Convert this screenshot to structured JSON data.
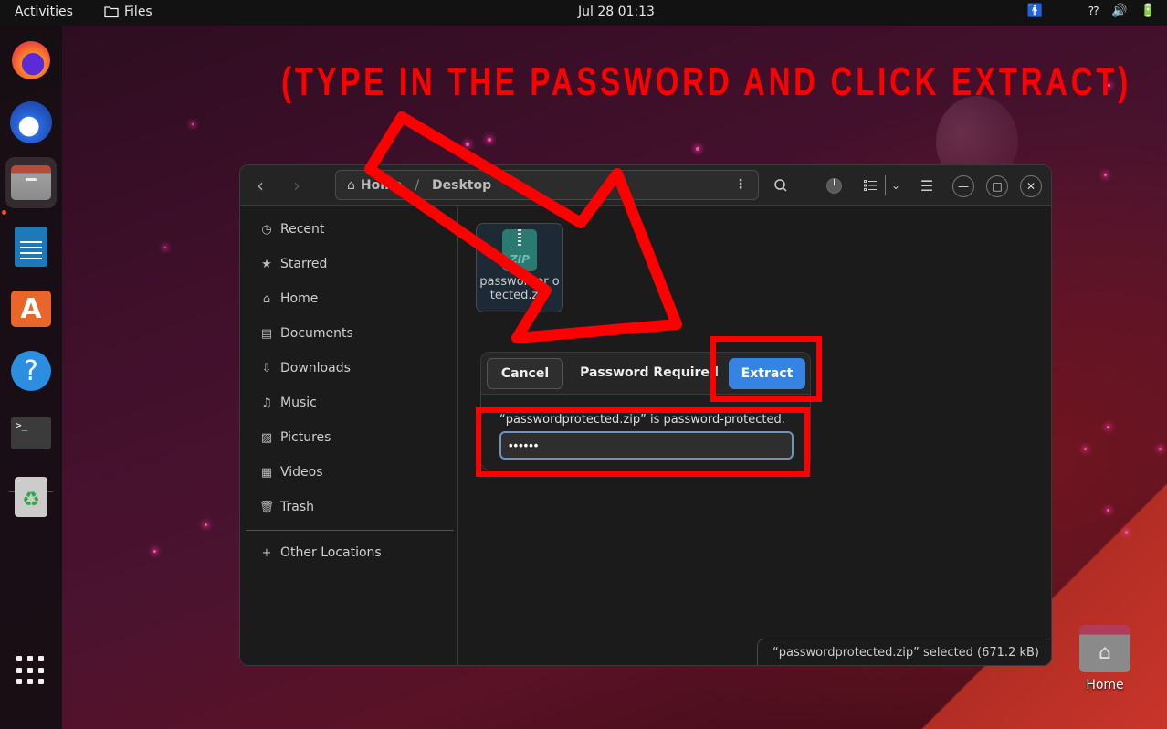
{
  "topbar": {
    "activities": "Activities",
    "app_name": "Files",
    "clock": "Jul 28  01:13",
    "tray": {
      "accessibility_icon": "accessibility-icon",
      "network_icon": "network-unknown-icon",
      "volume_icon": "volume-icon",
      "battery_icon": "battery-charging-icon"
    }
  },
  "dock": {
    "items": [
      {
        "name": "Firefox",
        "icon": "firefox-icon"
      },
      {
        "name": "Thunderbird",
        "icon": "thunderbird-icon"
      },
      {
        "name": "Files",
        "icon": "files-icon",
        "active": true
      },
      {
        "name": "LibreOffice Writer",
        "icon": "writer-icon"
      },
      {
        "name": "Ubuntu Software",
        "icon": "software-icon",
        "glyph": "A"
      },
      {
        "name": "Help",
        "icon": "help-icon",
        "glyph": "?"
      },
      {
        "name": "Terminal",
        "icon": "terminal-icon",
        "glyph": ">_"
      },
      {
        "name": "Trash",
        "icon": "trash-icon",
        "glyph": "♻"
      }
    ],
    "show_apps": "show-applications-icon"
  },
  "annotation": {
    "text": "(TYPE IN THE PASSWORD AND CLICK EXTRACT)",
    "color": "#ff0000"
  },
  "window": {
    "pathbar": {
      "home": "Home",
      "separator": "/",
      "current": "Desktop"
    },
    "sidebar": {
      "items": [
        {
          "label": "Recent",
          "icon": "clock-icon",
          "glyph": "◷"
        },
        {
          "label": "Starred",
          "icon": "star-icon",
          "glyph": "★"
        },
        {
          "label": "Home",
          "icon": "home-icon",
          "glyph": "⌂"
        },
        {
          "label": "Documents",
          "icon": "document-icon",
          "glyph": "▤"
        },
        {
          "label": "Downloads",
          "icon": "download-icon",
          "glyph": "⇩"
        },
        {
          "label": "Music",
          "icon": "music-icon",
          "glyph": "♫"
        },
        {
          "label": "Pictures",
          "icon": "picture-icon",
          "glyph": "▨"
        },
        {
          "label": "Videos",
          "icon": "video-icon",
          "glyph": "▦"
        },
        {
          "label": "Trash",
          "icon": "trash-icon",
          "glyph": "🗑"
        }
      ],
      "other_locations": {
        "label": "Other Locations",
        "glyph": "+"
      }
    },
    "files": [
      {
        "name": "passwordprotected.zip",
        "display_name": "passwordpr otected.zip",
        "type": "zip",
        "icon_label": "ZIP"
      }
    ],
    "status": "“passwordprotected.zip” selected  (671.2 kB)"
  },
  "dialog": {
    "title": "Password Required",
    "cancel_label": "Cancel",
    "extract_label": "Extract",
    "message": "“passwordprotected.zip” is password-protected.",
    "password_value": "••••••",
    "accent": "#3584e4"
  },
  "desktop": {
    "home_label": "Home"
  }
}
